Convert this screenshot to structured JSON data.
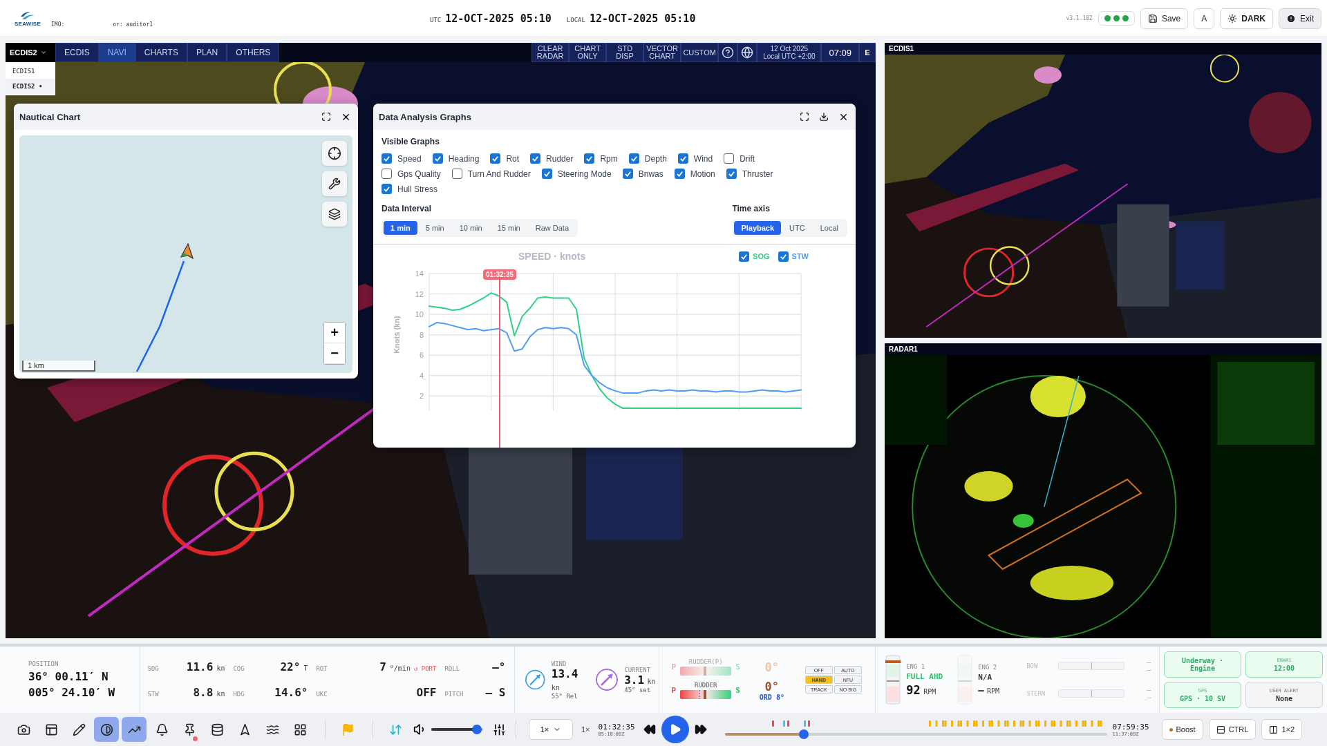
{
  "top_bar": {
    "logo": "SEAWISE",
    "imo_label": "IMO:",
    "user": "or: auditor1",
    "utc_label": "UTC",
    "utc_time": "12-OCT-2025 05:10",
    "local_label": "LOCAL",
    "local_time": "12-OCT-2025 05:10",
    "version": "v3.1.102",
    "buttons": [
      {
        "kind": "save",
        "label": "Save"
      },
      {
        "kind": "font",
        "label": "A"
      },
      {
        "kind": "theme",
        "label": "DARK"
      },
      {
        "kind": "exit",
        "label": "Exit"
      }
    ]
  },
  "main_screen": {
    "selector": "ECDIS2",
    "selected_mark": "•",
    "menu": [
      {
        "label": "ECDIS1",
        "selected": false
      },
      {
        "label": "ECDIS2",
        "selected": true
      }
    ],
    "tabs": [
      {
        "label": "ECDIS",
        "selected": false
      },
      {
        "label": "NAVI",
        "selected": true
      },
      {
        "label": "CHARTS",
        "selected": false
      },
      {
        "label": "PLAN",
        "selected": false
      },
      {
        "label": "OTHERS",
        "selected": false
      }
    ],
    "tools": [
      "CLEAR RADAR",
      "CHART ONLY",
      "STD DISP",
      "VECTOR CHART",
      "CUSTOM"
    ],
    "date": "12 Oct 2025",
    "zone": "Local UTC +2:00",
    "clock": "07:09",
    "mode": "E"
  },
  "nautical_chart": {
    "title": "Nautical Chart",
    "scale": "1 km",
    "zoom_in": "+",
    "zoom_out": "−"
  },
  "data_analysis": {
    "title": "Data Analysis Graphs",
    "visible_graphs_label": "Visible Graphs",
    "graph_rows": [
      [
        {
          "label": "Speed",
          "checked": true
        },
        {
          "label": "Heading",
          "checked": true
        },
        {
          "label": "Rot",
          "checked": true
        },
        {
          "label": "Rudder",
          "checked": true
        },
        {
          "label": "Rpm",
          "checked": true
        },
        {
          "label": "Depth",
          "checked": true
        },
        {
          "label": "Wind",
          "checked": true
        },
        {
          "label": "Drift",
          "checked": false
        }
      ],
      [
        {
          "label": "Gps Quality",
          "checked": false
        },
        {
          "label": "Turn And Rudder",
          "checked": false
        },
        {
          "label": "Steering Mode",
          "checked": true
        },
        {
          "label": "Bnwas",
          "checked": true
        },
        {
          "label": "Motion",
          "checked": true
        },
        {
          "label": "Thruster",
          "checked": true
        }
      ],
      [
        {
          "label": "Hull Stress",
          "checked": true
        }
      ]
    ],
    "interval_label": "Data Interval",
    "intervals": [
      {
        "label": "1 min",
        "selected": true
      },
      {
        "label": "5 min",
        "selected": false
      },
      {
        "label": "10 min",
        "selected": false
      },
      {
        "label": "15 min",
        "selected": false
      },
      {
        "label": "Raw Data",
        "selected": false
      }
    ],
    "time_axis_label": "Time axis",
    "time_axes": [
      {
        "label": "Playback",
        "selected": true
      },
      {
        "label": "UTC",
        "selected": false
      },
      {
        "label": "Local",
        "selected": false
      }
    ],
    "legend": [
      {
        "checked": true
      },
      {
        "checked": true
      }
    ],
    "playhead": "01:32:35",
    "chart_data": {
      "type": "line",
      "title": "SPEED · knots",
      "ylabel": "Knots (kn)",
      "grid": true,
      "ylim": [
        0.6,
        14
      ],
      "yticks": [
        2,
        4,
        6,
        8,
        10,
        12,
        14
      ],
      "series": [
        {
          "name": "SOG",
          "color": "#2fcf86",
          "values": [
            10.8,
            10.7,
            10.6,
            10.4,
            10.5,
            10.8,
            11.2,
            11.6,
            12.1,
            11.8,
            11.2,
            7.9,
            9.8,
            10.6,
            11.6,
            11.7,
            11.6,
            11.6,
            11.6,
            10.5,
            5.7,
            4.0,
            2.7,
            1.8,
            1.2,
            0.8,
            0.8,
            0.8,
            0.8,
            0.8,
            0.8,
            0.8,
            0.8,
            0.8,
            0.8,
            0.8,
            0.8,
            0.8,
            0.8,
            0.8,
            0.8,
            0.8,
            0.8,
            0.8,
            0.8,
            0.8,
            0.8,
            0.8,
            0.8
          ]
        },
        {
          "name": "STW",
          "color": "#4f9cf5",
          "values": [
            8.8,
            9.2,
            9.1,
            8.9,
            8.7,
            8.5,
            8.6,
            8.4,
            8.5,
            8.6,
            8.2,
            6.4,
            6.6,
            7.8,
            8.5,
            8.7,
            8.6,
            8.7,
            8.6,
            8.0,
            5.0,
            4.0,
            3.3,
            2.8,
            2.5,
            2.3,
            2.3,
            2.3,
            2.5,
            2.6,
            2.5,
            2.6,
            2.5,
            2.5,
            2.6,
            2.5,
            2.5,
            2.4,
            2.5,
            2.5,
            2.4,
            2.4,
            2.5,
            2.6,
            2.5,
            2.5,
            2.4,
            2.5,
            2.6
          ]
        }
      ]
    }
  },
  "side_screens": [
    {
      "kind": "ecdis",
      "label": "ECDIS1"
    },
    {
      "kind": "radar",
      "label": "RADAR1"
    }
  ],
  "status": {
    "position": {
      "label": "POSITION",
      "lat": "36° 00.11′ N",
      "lon": "005° 24.10′ W"
    },
    "readings": [
      {
        "label": "SOG",
        "value": "11.6",
        "unit": "kn"
      },
      {
        "label": "COG",
        "value": "22°",
        "unit": "T"
      },
      {
        "label": "ROT",
        "value": "7",
        "unit": "°/min",
        "note": "↺ PORT"
      },
      {
        "label": "ROLL",
        "value": "–°"
      },
      {
        "label": "STW",
        "value": "8.8",
        "unit": "kn"
      },
      {
        "label": "HDG",
        "value": "14.6°"
      },
      {
        "label": "UKC",
        "value": "OFF"
      },
      {
        "label": "PITCH",
        "value": "– S"
      }
    ],
    "vectors": [
      {
        "label": "WIND",
        "value": "13.4",
        "unit": "kn",
        "sub": "55° Rel",
        "color": "#3b9fe0"
      },
      {
        "label": "CURRENT",
        "value": "3.1",
        "unit": "kn",
        "sub": "45° set",
        "color": "#a66be0"
      }
    ],
    "rudders": [
      {
        "label": "RUDDER(P)",
        "port": "P",
        "stbd": "S",
        "angle": "0°",
        "active": false
      },
      {
        "label": "RUDDER",
        "port": "P",
        "stbd": "S",
        "angle": "0°",
        "active": true,
        "order": "ORD 8°"
      }
    ],
    "steering_modes": [
      {
        "label": "OFF",
        "selected": false
      },
      {
        "label": "AUTO",
        "selected": false
      },
      {
        "label": "HAND",
        "selected": true
      },
      {
        "label": "NFU",
        "selected": false
      },
      {
        "label": "TRACK",
        "selected": false
      },
      {
        "label": "NO SIG",
        "selected": false
      }
    ],
    "engines": [
      {
        "label": "ENG 1",
        "order": "FULL AHD",
        "rpm": "92",
        "unit": "RPM",
        "active": true
      },
      {
        "label": "ENG 2",
        "order": "N/A",
        "rpm": "—",
        "unit": "RPM",
        "active": false
      }
    ],
    "thrusters": [
      {
        "label": "BOW",
        "reading": "– –"
      },
      {
        "label": "STERN",
        "reading": "– –"
      }
    ],
    "tiles": [
      {
        "value": "Underway · Engine",
        "active": true
      },
      {
        "label": "BNWAS",
        "value": "12:00",
        "active": true
      },
      {
        "label": "GPS",
        "value": "GPS · 10 SV",
        "active": true
      },
      {
        "label": "USER ALERT",
        "value": "None",
        "active": false
      }
    ]
  },
  "toolbar": {
    "tool_groups": [
      [
        {
          "kind": "camera",
          "selected": false,
          "alert": false
        },
        {
          "kind": "layout",
          "selected": false,
          "alert": false
        },
        {
          "kind": "pencil",
          "selected": false,
          "alert": false
        },
        {
          "kind": "contrast",
          "selected": true,
          "alert": false
        },
        {
          "kind": "trend",
          "selected": true,
          "alert": false
        },
        {
          "kind": "bell",
          "selected": false,
          "alert": false
        },
        {
          "kind": "pin",
          "selected": false,
          "alert": true
        },
        {
          "kind": "database",
          "selected": false,
          "alert": false
        },
        {
          "kind": "north",
          "selected": false,
          "alert": false
        },
        {
          "kind": "waves",
          "selected": false,
          "alert": false
        },
        {
          "kind": "grid",
          "selected": false,
          "alert": false
        }
      ],
      [
        {
          "kind": "flag",
          "selected": false,
          "alert": false
        }
      ],
      [
        {
          "kind": "sync",
          "selected": false,
          "alert": false
        }
      ]
    ],
    "volume": {
      "level": 0.97
    },
    "speed_select": "1×",
    "speed": "1×",
    "current_time": "01:32:35",
    "current_utc": "05:10:09Z",
    "timeline": {
      "level": 0.2
    },
    "end_time": "07:59:35",
    "end_utc": "11:37:09Z",
    "buttons": [
      {
        "kind": "boost",
        "label": "Boost"
      },
      {
        "kind": "ctrl",
        "label": "CTRL"
      },
      {
        "kind": "split",
        "label": "1×2"
      }
    ]
  }
}
